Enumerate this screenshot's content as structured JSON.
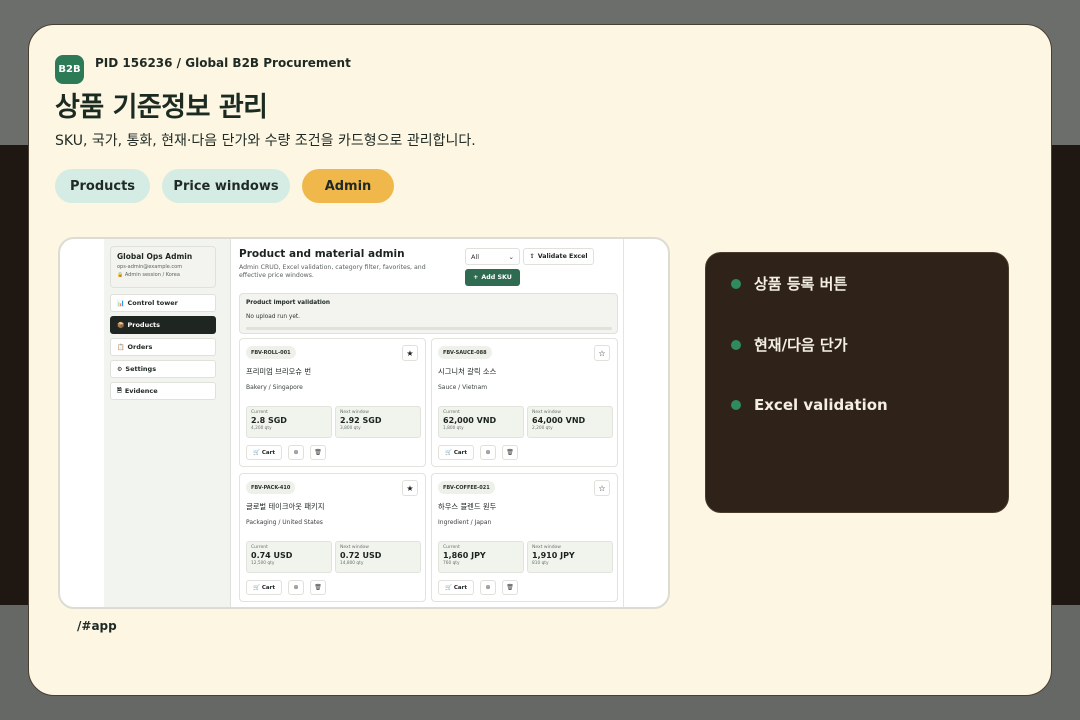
{
  "header": {
    "logo": "B2B",
    "pid": "PID 156236 / Global B2B Procurement",
    "title": "상품 기준정보 관리",
    "subtitle": "SKU, 국가, 통화, 현재·다음 단가와 수량 조건을 카드형으로 관리합니다."
  },
  "tabs": [
    {
      "label": "Products",
      "active": false
    },
    {
      "label": "Price windows",
      "active": false
    },
    {
      "label": "Admin",
      "active": true
    }
  ],
  "app": {
    "account": {
      "name": "Global Ops Admin",
      "email": "ops-admin@example.com",
      "session": "Admin session / Korea"
    },
    "nav": [
      {
        "icon": "dashboard-icon",
        "glyph": "📊",
        "label": "Control tower",
        "active": false
      },
      {
        "icon": "box-icon",
        "glyph": "📦",
        "label": "Products",
        "active": true
      },
      {
        "icon": "document-icon",
        "glyph": "📋",
        "label": "Orders",
        "active": false
      },
      {
        "icon": "settings-icon",
        "glyph": "⚙",
        "label": "Settings",
        "active": false
      },
      {
        "icon": "evidence-icon",
        "glyph": "🗎",
        "label": "Evidence",
        "active": false
      }
    ],
    "main": {
      "title": "Product and material admin",
      "description": "Admin CRUD, Excel validation, category filter, favorites, and effective price windows.",
      "filter_value": "All",
      "validate_label": "Validate Excel",
      "add_label": "Add SKU"
    },
    "import": {
      "title": "Product import validation",
      "status": "No upload run yet."
    },
    "products": [
      {
        "sku": "FBV-ROLL-001",
        "name": "프리미엄 브리오슈 번",
        "category": "Bakery / Singapore",
        "favorite": true,
        "current_label": "Current",
        "current_price": "2.8 SGD",
        "current_qty": "4,200 qty",
        "next_label": "Next window",
        "next_price": "2.92 SGD",
        "next_qty": "3,800 qty",
        "cart_label": "Cart"
      },
      {
        "sku": "FBV-SAUCE-088",
        "name": "시그니처 갈릭 소스",
        "category": "Sauce / Vietnam",
        "favorite": false,
        "current_label": "Current",
        "current_price": "62,000 VND",
        "current_qty": "1,800 qty",
        "next_label": "Next window",
        "next_price": "64,000 VND",
        "next_qty": "2,200 qty",
        "cart_label": "Cart"
      },
      {
        "sku": "FBV-PACK-410",
        "name": "글로벌 테이크아웃 패키지",
        "category": "Packaging / United States",
        "favorite": true,
        "current_label": "Current",
        "current_price": "0.74 USD",
        "current_qty": "12,500 qty",
        "next_label": "Next window",
        "next_price": "0.72 USD",
        "next_qty": "14,800 qty",
        "cart_label": "Cart"
      },
      {
        "sku": "FBV-COFFEE-021",
        "name": "하우스 블렌드 원두",
        "category": "Ingredient / Japan",
        "favorite": false,
        "current_label": "Current",
        "current_price": "1,860 JPY",
        "current_qty": "760 qty",
        "next_label": "Next window",
        "next_price": "1,910 JPY",
        "next_qty": "810 qty",
        "cart_label": "Cart"
      }
    ]
  },
  "path": "/#app",
  "features": [
    "상품 등록 버튼",
    "현재/다음 단가",
    "Excel validation"
  ],
  "colors": {
    "accent": "#2c7a56",
    "active_tab": "#f0b84b",
    "tab": "#d4ece4",
    "card": "#fdf6e3",
    "panel": "#2e2219"
  }
}
